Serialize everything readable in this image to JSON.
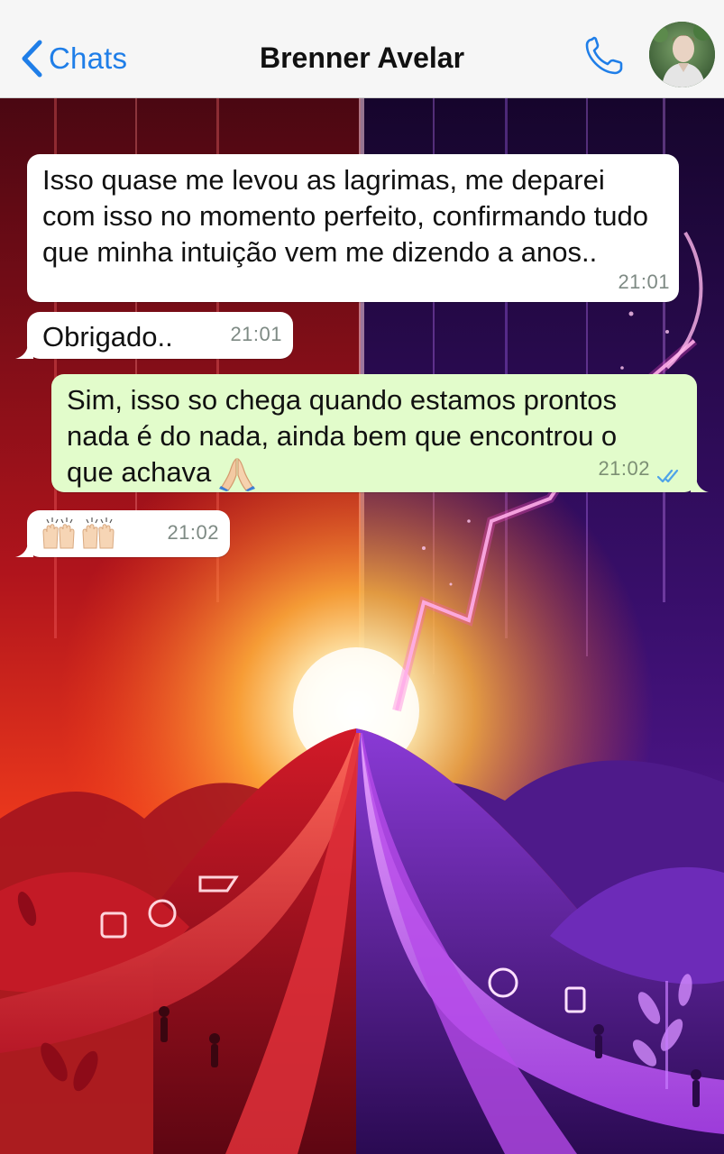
{
  "header": {
    "back_label": "Chats",
    "contact_name": "Brenner Avelar",
    "back_icon": "chevron-left-icon",
    "call_icon": "phone-icon",
    "accent_color": "#1f7ee8"
  },
  "messages": [
    {
      "direction": "incoming",
      "text": "Isso quase me levou as lagrimas, me deparei com isso no momento perfeito, confirmando tudo que minha intuição vem me dizendo a anos..",
      "time": "21:01"
    },
    {
      "direction": "incoming",
      "text": "Obrigado..",
      "time": "21:01"
    },
    {
      "direction": "outgoing",
      "text": "Sim, isso so chega quando estamos prontos nada é do nada, ainda bem que encontrou o que achava",
      "emoji": "folded-hands-emoji",
      "time": "21:02",
      "status": "read"
    },
    {
      "direction": "incoming",
      "emoji": "raising-hands-emoji x2",
      "time": "21:02"
    }
  ],
  "colors": {
    "incoming_bubble": "#ffffff",
    "outgoing_bubble": "#e2fccb",
    "read_ticks": "#4fa3e8"
  }
}
